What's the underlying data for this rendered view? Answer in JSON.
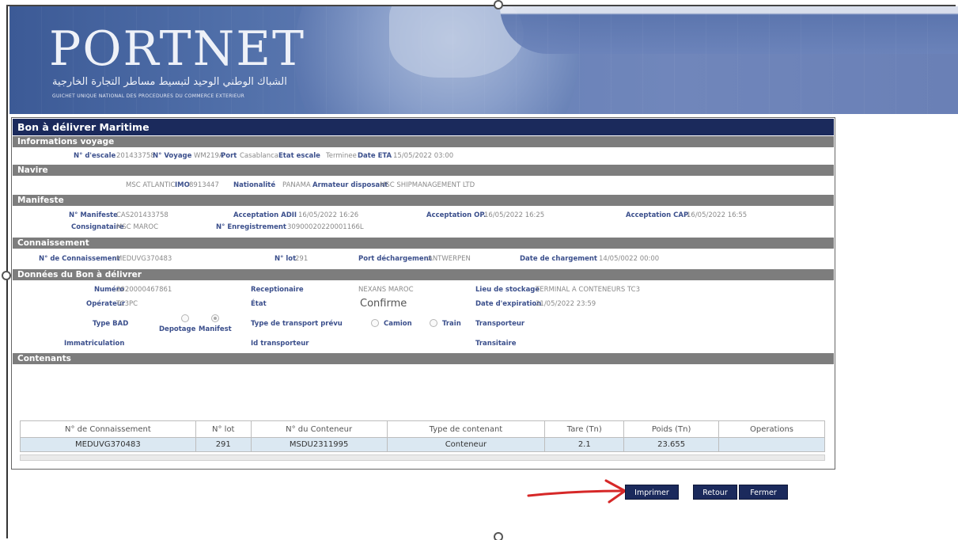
{
  "banner": {
    "logo": "PORTNET",
    "arabic": "الشباك الوطني الوحيد لتبسيط مساطر التجارة الخارجية",
    "subtitle": "GUICHET UNIQUE NATIONAL DES PROCEDURES DU COMMERCE EXTERIEUR"
  },
  "panel": {
    "title": "Bon à délivrer Maritime"
  },
  "voyage": {
    "section": "Informations voyage",
    "escale_label": "N° d'escale",
    "escale": "201433758",
    "voyage_label": "N° Voyage",
    "voyage": "WM219A",
    "port_label": "Port",
    "port": "Casablanca",
    "etat_label": "Etat escale",
    "etat": "Terminee",
    "eta_label": "Date ETA",
    "eta": "15/05/2022 03:00"
  },
  "navire": {
    "section": "Navire",
    "nom": "MSC ATLANTIC",
    "imo_label": "IMO",
    "imo": "8913447",
    "nat_label": "Nationalité",
    "nat": "PANAMA",
    "armateur_label": "Armateur disposant",
    "armateur": "MSC SHIPMANAGEMENT LTD"
  },
  "manifeste": {
    "section": "Manifeste",
    "num_label": "N° Manifeste",
    "num": "CAS201433758",
    "adii_label": "Acceptation ADII",
    "adii": "16/05/2022 16:26",
    "op_label": "Acceptation OP.",
    "op": "16/05/2022 16:25",
    "cap_label": "Acceptation CAP.",
    "cap": "16/05/2022 16:55",
    "consignataire_label": "Consignataire",
    "consignataire": "MSC MAROC",
    "enreg_label": "N° Enregistrement",
    "enreg": "30900020220001166L"
  },
  "connaissement": {
    "section": "Connaissement",
    "num_label": "N° de Connaissement",
    "num": "MEDUVG370483",
    "lot_label": "N° lot",
    "lot": "291",
    "port_label": "Port déchargement",
    "port": "ANTWERPEN",
    "date_label": "Date de chargement",
    "date": "14/05/0022 00:00"
  },
  "bad": {
    "section": "Données du Bon à délivrer",
    "numero_label": "Numéro",
    "numero": "2020000467861",
    "recept_label": "Receptionaire",
    "recept": "NEXANS MAROC",
    "stockage_label": "Lieu de stockage",
    "stockage": "TERMINAL A CONTENEURS TC3",
    "operateur_label": "Opérateur",
    "operateur": "TC3PC",
    "etat_label": "État",
    "etat": "Confirme",
    "expiration_label": "Date d'expiration",
    "expiration": "21/05/2022 23:59",
    "type_label": "Type BAD",
    "opt_depotage": "Depotage",
    "opt_manifest": "Manifest",
    "transport_label": "Type de transport prévu",
    "opt_camion": "Camion",
    "opt_train": "Train",
    "transporteur_label": "Transporteur",
    "immat_label": "Immatriculation",
    "idtrans_label": "Id transporteur",
    "transitaire_label": "Transitaire"
  },
  "contenants": {
    "section": "Contenants",
    "headers": [
      "N° de Connaissement",
      "N° lot",
      "N° du Conteneur",
      "Type de contenant",
      "Tare (Tn)",
      "Poids (Tn)",
      "Operations"
    ],
    "rows": [
      [
        "MEDUVG370483",
        "291",
        "MSDU2311995",
        "Conteneur",
        "2.1",
        "23.655",
        ""
      ]
    ]
  },
  "buttons": {
    "imprimer": "Imprimer",
    "retour": "Retour",
    "fermer": "Fermer"
  },
  "colors": {
    "title_bar": "#1b2a5c",
    "section_bar": "#7d7d7d",
    "label": "#3b4f8c",
    "annotation_arrow": "#d62828"
  }
}
